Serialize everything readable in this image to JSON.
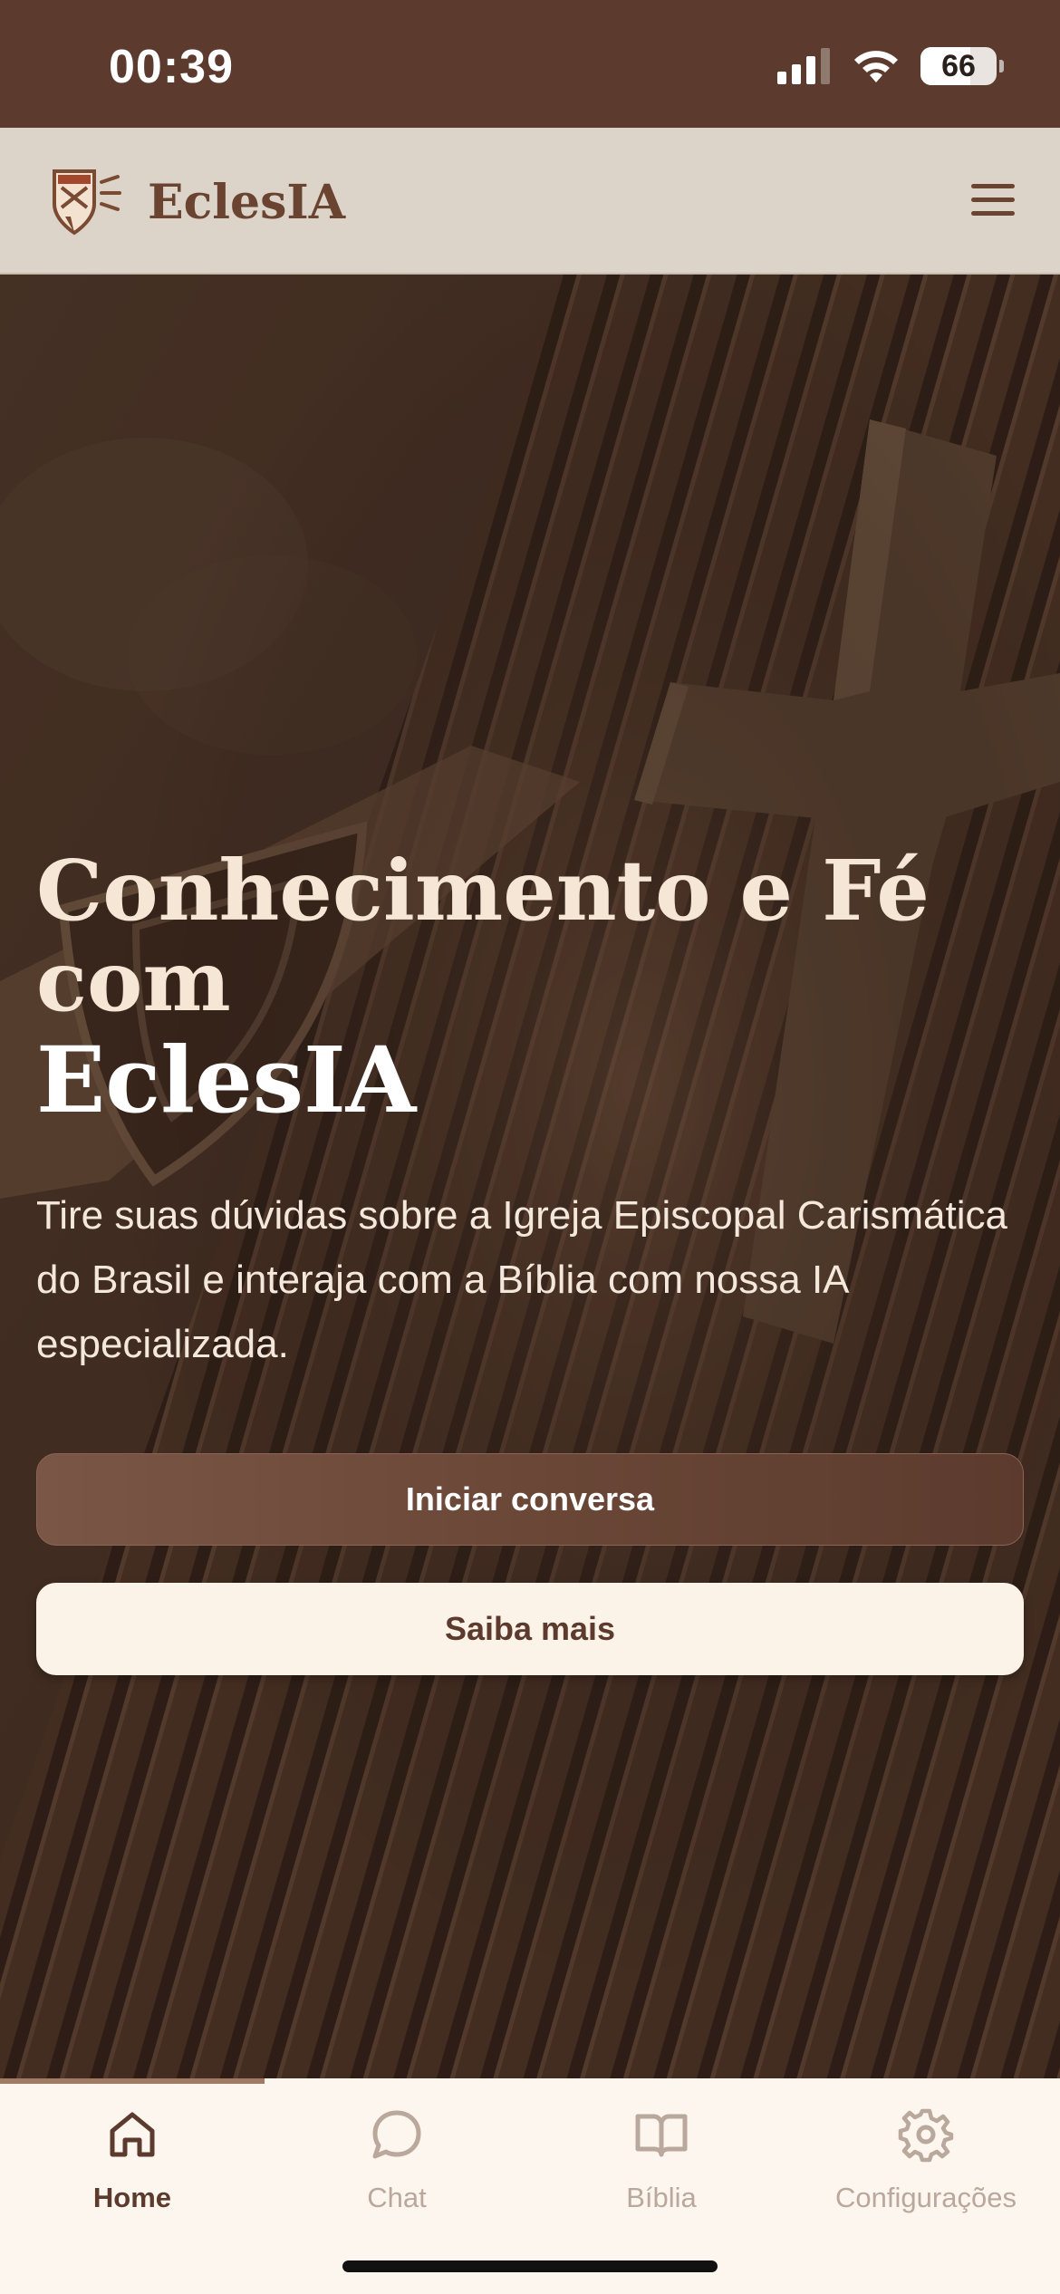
{
  "status_bar": {
    "time": "00:39",
    "battery_percent": "66",
    "battery_level": 0.66
  },
  "header": {
    "brand": "EclesIA",
    "logo_icon": "shield-cross-logo-icon",
    "menu_icon": "hamburger-menu-icon"
  },
  "hero": {
    "title_line1": "Conhecimento e Fé",
    "title_line2": "com",
    "title_line3": "EclesIA",
    "description": "Tire suas dúvidas sobre a Igreja Episcopal Carismática do Brasil e interaja com a Bíblia com nossa IA especializada.",
    "primary_button": "Iniciar conversa",
    "secondary_button": "Saiba mais"
  },
  "tabbar": {
    "tabs": [
      {
        "label": "Home",
        "icon": "home-icon",
        "active": true
      },
      {
        "label": "Chat",
        "icon": "chat-bubble-icon",
        "active": false
      },
      {
        "label": "Bíblia",
        "icon": "book-open-icon",
        "active": false
      },
      {
        "label": "Configurações",
        "icon": "gear-icon",
        "active": false
      }
    ]
  },
  "colors": {
    "brand_brown": "#5c3b2e",
    "header_bg": "#dcd3c9",
    "tab_bg": "#fcf6ee",
    "inactive_tab": "#b9a89b"
  }
}
